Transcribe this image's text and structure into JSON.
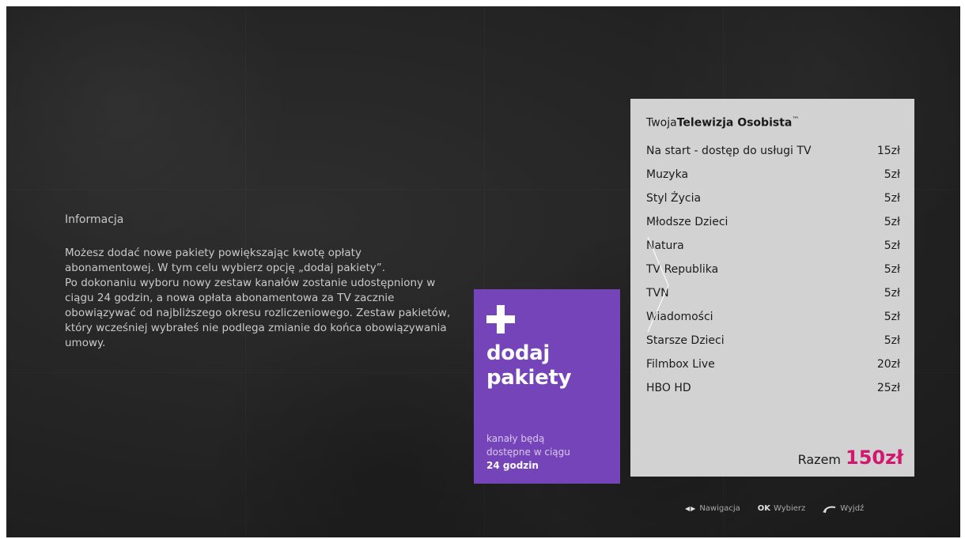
{
  "info": {
    "title": "Informacja",
    "paragraph1": "Możesz dodać nowe pakiety powiększając kwotę opłaty abonamentowej. W tym celu wybierz opcję „dodaj pakiety”.",
    "paragraph2": "Po dokonaniu wyboru nowy zestaw kanałów zostanie udostępniony w ciągu 24 godzin, a nowa opłata abonamentowa za TV zacznie obowiązywać od najbliższego okresu rozliczeniowego. Zestaw pakietów, który wcześniej wybrałeś nie podlega zmianie do końca obowiązywania umowy."
  },
  "add_tile": {
    "line1": "dodaj",
    "line2": "pakiety",
    "sub1": "kanały będą",
    "sub2": "dostępne w ciągu",
    "sub3": "24 godzin",
    "background_color": "#7544b8"
  },
  "summary": {
    "title_prefix": "Twoja",
    "title_bold": "Telewizja Osobista",
    "title_tm": "™",
    "packages": [
      {
        "name": "Na start - dostęp do usługi TV",
        "price": "15zł"
      },
      {
        "name": "Muzyka",
        "price": "5zł"
      },
      {
        "name": "Styl Życia",
        "price": "5zł"
      },
      {
        "name": "Młodsze Dzieci",
        "price": "5zł"
      },
      {
        "name": "Natura",
        "price": "5zł"
      },
      {
        "name": "TV Republika",
        "price": "5zł"
      },
      {
        "name": "TVN",
        "price": "5zł"
      },
      {
        "name": "Wiadomości",
        "price": "5zł"
      },
      {
        "name": "Starsze Dzieci",
        "price": "5zł"
      },
      {
        "name": "Filmbox Live",
        "price": "20zł"
      },
      {
        "name": "HBO HD",
        "price": "25zł"
      }
    ],
    "total_label": "Razem",
    "total_value": "150zł",
    "total_color": "#d1176e"
  },
  "hints": {
    "navigation_label": "Nawigacja",
    "ok_key": "OK",
    "ok_label": "Wybierz",
    "exit_label": "Wyjdź",
    "navigation_icon": "left-right-arrows-icon",
    "exit_icon": "back-arrow-icon"
  }
}
